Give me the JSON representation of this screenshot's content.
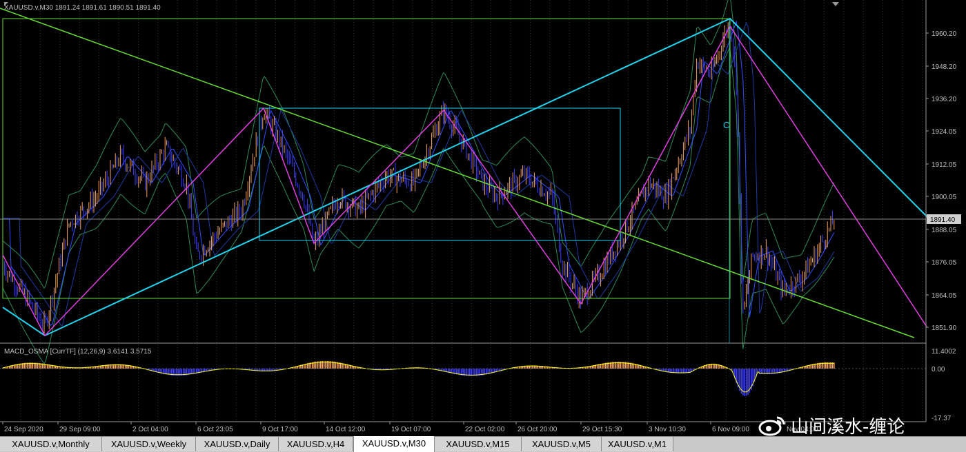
{
  "window": {
    "title_info": "XAUUSD.v,M30  1891.24 1891.61 1890.51 1891.40",
    "indicator_info": "MACD_OSMA [CurrTF] (12,26,9) 3.6141  3.5715",
    "current_price_label": "1891.40",
    "wave_label": "C"
  },
  "price_axis": {
    "labels": [
      "1960.20",
      "1948.20",
      "1936.20",
      "1924.05",
      "1912.05",
      "1900.05",
      "1888.05",
      "1876.05",
      "1864.05",
      "1851.90"
    ],
    "range": [
      1847.5,
      1967.0
    ]
  },
  "macd_axis": {
    "labels": [
      "11.4002",
      "0.00",
      "-17.37"
    ]
  },
  "time_axis": {
    "labels": [
      "24 Sep 2020",
      "29 Sep 09:00",
      "2 Oct 04:00",
      "6 Oct 23:05",
      "9 Oct 17:00",
      "14 Oct 12:00",
      "19 Oct 07:00",
      "22 Oct 02:00",
      "26 Oct 20:00",
      "29 Oct 15:30",
      "3 Nov 10:30",
      "6 Nov 09:00",
      "Nov 04:00"
    ]
  },
  "tabs": [
    {
      "label": "XAUUSD.v,Monthly",
      "active": false
    },
    {
      "label": "XAUUSD.v,Weekly",
      "active": false
    },
    {
      "label": "XAUUSD.v,Daily",
      "active": false
    },
    {
      "label": "XAUUSD.v,H4",
      "active": false
    },
    {
      "label": "XAUUSD.v,M30",
      "active": true
    },
    {
      "label": "XAUUSD.v,M15",
      "active": false
    },
    {
      "label": "XAUUSD.v,M5",
      "active": false
    },
    {
      "label": "XAUUSD.v,M1",
      "active": false
    }
  ],
  "watermark": {
    "text": "山间溪水-缠论"
  },
  "colors": {
    "background": "#000000",
    "grid": "#3a3a3a",
    "candle_up": "#f4a460",
    "candle_down": "#4040ff",
    "cyan_line": "#22d3ee",
    "magenta_line": "#e040e0",
    "green_line": "#66dd33",
    "bollinger": "#2e8b57",
    "ma_blue": "#3050ff",
    "macd_signal": "#ffff00",
    "axis_text": "#c0c0c0"
  }
}
